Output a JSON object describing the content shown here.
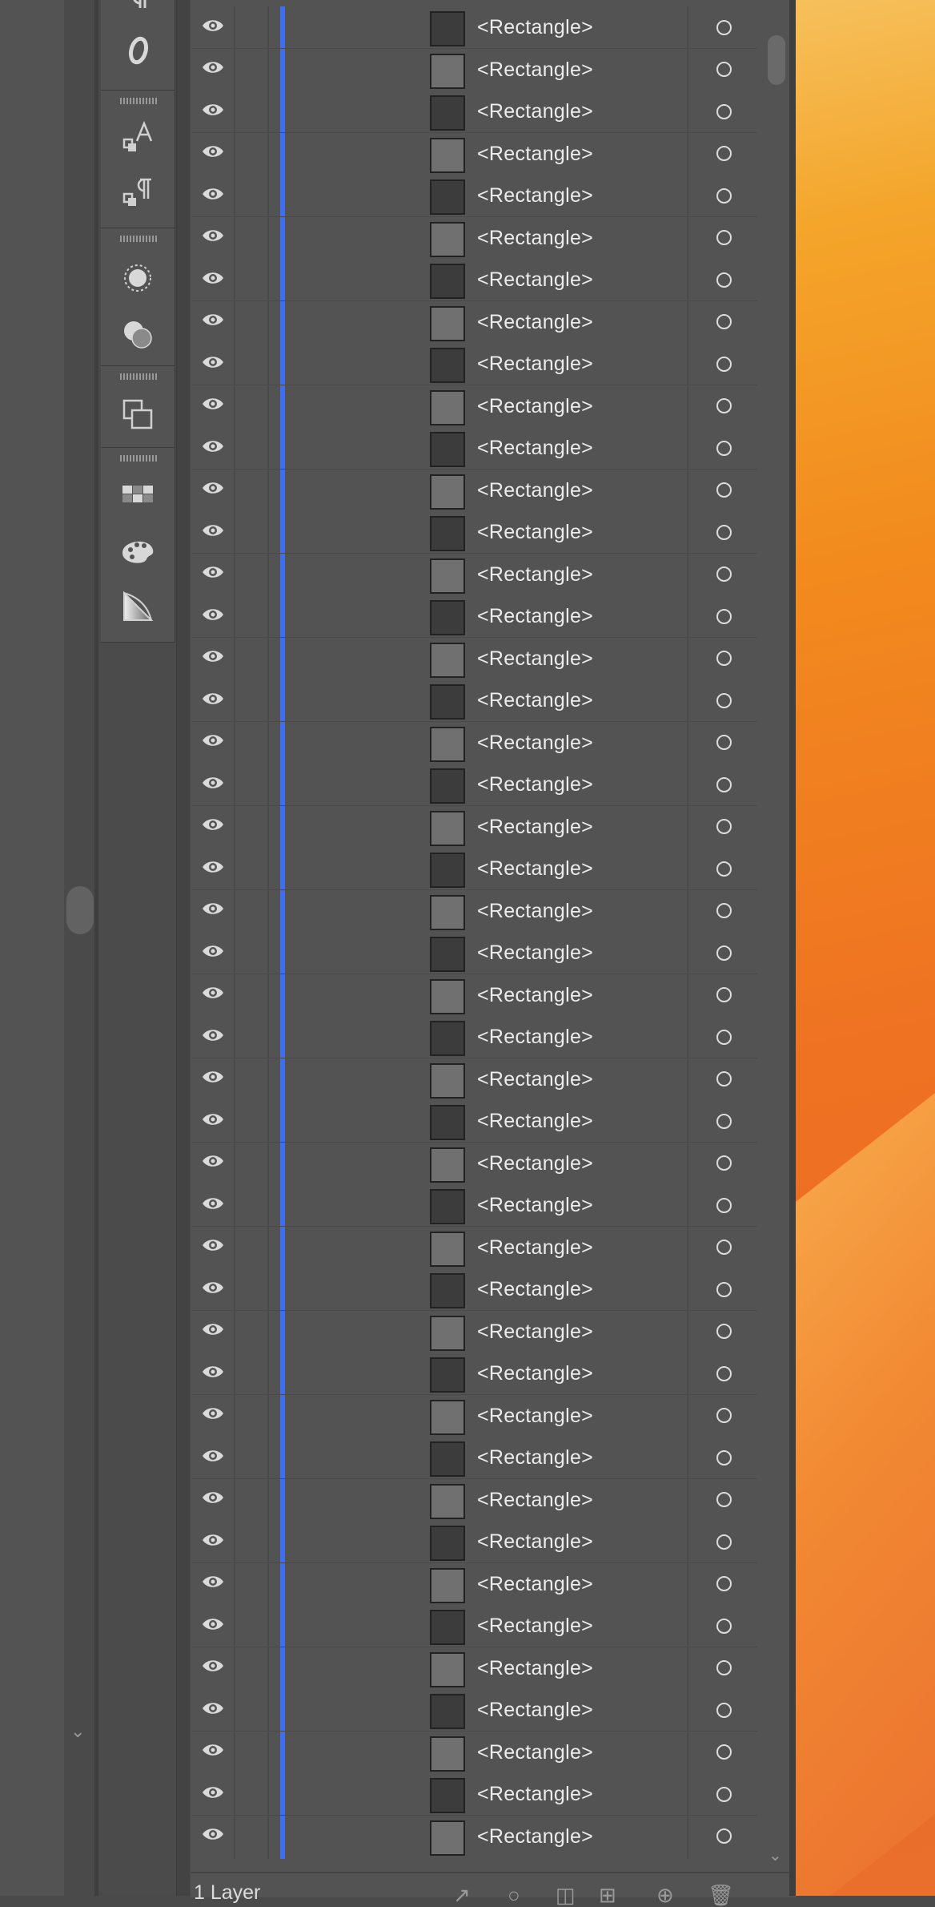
{
  "layers_panel": {
    "rows": [
      {
        "label": "<Rectangle>",
        "swatch": "dark"
      },
      {
        "label": "<Rectangle>",
        "swatch": "light"
      },
      {
        "label": "<Rectangle>",
        "swatch": "dark"
      },
      {
        "label": "<Rectangle>",
        "swatch": "light"
      },
      {
        "label": "<Rectangle>",
        "swatch": "dark"
      },
      {
        "label": "<Rectangle>",
        "swatch": "light"
      },
      {
        "label": "<Rectangle>",
        "swatch": "dark"
      },
      {
        "label": "<Rectangle>",
        "swatch": "light"
      },
      {
        "label": "<Rectangle>",
        "swatch": "dark"
      },
      {
        "label": "<Rectangle>",
        "swatch": "light"
      },
      {
        "label": "<Rectangle>",
        "swatch": "dark"
      },
      {
        "label": "<Rectangle>",
        "swatch": "light"
      },
      {
        "label": "<Rectangle>",
        "swatch": "dark"
      },
      {
        "label": "<Rectangle>",
        "swatch": "light"
      },
      {
        "label": "<Rectangle>",
        "swatch": "dark"
      },
      {
        "label": "<Rectangle>",
        "swatch": "light"
      },
      {
        "label": "<Rectangle>",
        "swatch": "dark"
      },
      {
        "label": "<Rectangle>",
        "swatch": "light"
      },
      {
        "label": "<Rectangle>",
        "swatch": "dark"
      },
      {
        "label": "<Rectangle>",
        "swatch": "light"
      },
      {
        "label": "<Rectangle>",
        "swatch": "dark"
      },
      {
        "label": "<Rectangle>",
        "swatch": "light"
      },
      {
        "label": "<Rectangle>",
        "swatch": "dark"
      },
      {
        "label": "<Rectangle>",
        "swatch": "light"
      },
      {
        "label": "<Rectangle>",
        "swatch": "dark"
      },
      {
        "label": "<Rectangle>",
        "swatch": "light"
      },
      {
        "label": "<Rectangle>",
        "swatch": "dark"
      },
      {
        "label": "<Rectangle>",
        "swatch": "light"
      },
      {
        "label": "<Rectangle>",
        "swatch": "dark"
      },
      {
        "label": "<Rectangle>",
        "swatch": "light"
      },
      {
        "label": "<Rectangle>",
        "swatch": "dark"
      },
      {
        "label": "<Rectangle>",
        "swatch": "light"
      },
      {
        "label": "<Rectangle>",
        "swatch": "dark"
      },
      {
        "label": "<Rectangle>",
        "swatch": "light"
      },
      {
        "label": "<Rectangle>",
        "swatch": "dark"
      },
      {
        "label": "<Rectangle>",
        "swatch": "light"
      },
      {
        "label": "<Rectangle>",
        "swatch": "dark"
      },
      {
        "label": "<Rectangle>",
        "swatch": "light"
      },
      {
        "label": "<Rectangle>",
        "swatch": "dark"
      },
      {
        "label": "<Rectangle>",
        "swatch": "light"
      },
      {
        "label": "<Rectangle>",
        "swatch": "dark"
      },
      {
        "label": "<Rectangle>",
        "swatch": "light"
      },
      {
        "label": "<Rectangle>",
        "swatch": "dark"
      },
      {
        "label": "<Rectangle>",
        "swatch": "light"
      },
      {
        "label": "<Rectangle>"
      }
    ],
    "footer": {
      "layer_count": "1 Layer",
      "actions": [
        "export-icon",
        "locate-object-icon",
        "make-clipping-mask-icon",
        "create-sublayer-icon",
        "new-layer-icon",
        "trash-icon"
      ]
    },
    "layer_color": "#3f6ef0"
  },
  "toolbar": {
    "tools": [
      "paragraph-icon",
      "opentype-icon",
      "character-styles-icon",
      "paragraph-styles-icon",
      "appearance-icon",
      "transparency-icon",
      "transform-icon",
      "swatches-icon",
      "color-guide-icon",
      "gradient-icon"
    ]
  }
}
